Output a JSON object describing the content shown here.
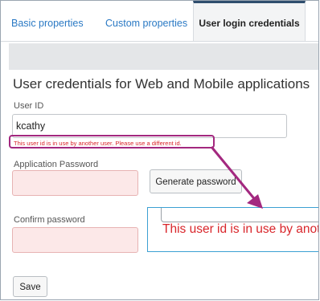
{
  "tabs": [
    {
      "label": "Basic properties"
    },
    {
      "label": "Custom properties"
    },
    {
      "label": "User login credentials"
    }
  ],
  "heading": "User credentials for Web and Mobile applications",
  "user_id": {
    "label": "User ID",
    "value": "kcathy",
    "error": "This user id is in use by another user. Please use a different id."
  },
  "password": {
    "label": "Application Password",
    "value": "",
    "generate_label": "Generate password"
  },
  "confirm": {
    "label": "Confirm password",
    "value": ""
  },
  "save_label": "Save",
  "callout": {
    "text": "This user id is in use by another user. Please use a different id."
  },
  "colors": {
    "accent": "#2a79c4",
    "error": "#d9262b",
    "highlight": "#a3287f",
    "callout_border": "#3ca0d3"
  }
}
